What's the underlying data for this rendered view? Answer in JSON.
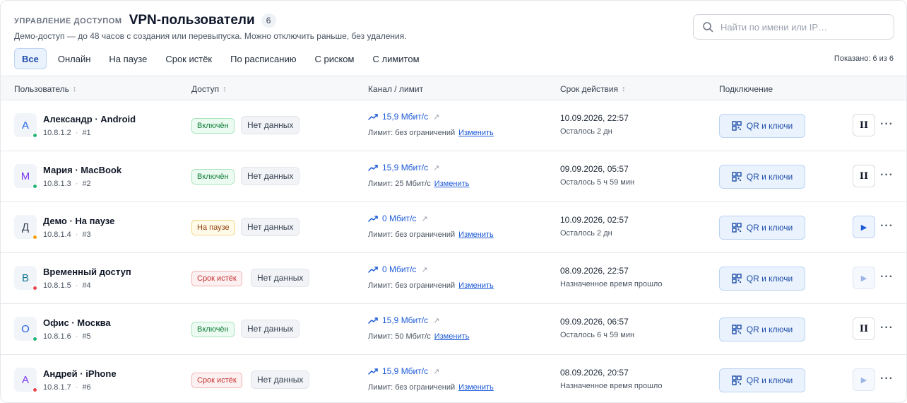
{
  "header": {
    "section_label": "Управление доступом",
    "title": "VPN-пользователи",
    "count": "6",
    "subtitle": "Демо-доступ — до 48 часов с создания или перевыпуска. Можно отключить раньше, без удаления."
  },
  "search": {
    "placeholder": "Найти по имени или IP…",
    "icon": "search-icon"
  },
  "tabs": [
    {
      "label": "Все",
      "active": true
    },
    {
      "label": "Онлайн"
    },
    {
      "label": "На паузе"
    },
    {
      "label": "Срок истёк"
    },
    {
      "label": "По расписанию"
    },
    {
      "label": "С риском"
    },
    {
      "label": "С лимитом"
    }
  ],
  "shown_text": "Показано: 6 из 6",
  "columns": {
    "user": "Пользователь",
    "access": "Доступ",
    "channel": "Канал / лимит",
    "expiry": "Срок действия",
    "connection": "Подключение"
  },
  "colors": {
    "accent": "#1d5bd8",
    "online": "#22b573",
    "paused": "#f59e0b",
    "expired": "#e5484d"
  },
  "rows": [
    {
      "initial": "А",
      "initial_color": "#2563eb",
      "name": "Александр · Android",
      "ip": "10.8.1.2",
      "num": "#1",
      "dot": "#22b573",
      "status": "Включён",
      "status_kind": "on",
      "data": "Нет данных",
      "speed": "15,9 Мбит/с",
      "limit": "Лимит: без ограничений",
      "change": "Изменить",
      "exp_date": "10.09.2026, 22:57",
      "exp_left": "Осталось 2 дн",
      "qr": "QR и ключи",
      "control": "pause"
    },
    {
      "initial": "М",
      "initial_color": "#7c3aed",
      "name": "Мария · MacBook",
      "ip": "10.8.1.3",
      "num": "#2",
      "dot": "#22b573",
      "status": "Включён",
      "status_kind": "on",
      "data": "Нет данных",
      "speed": "15,9 Мбит/с",
      "limit": "Лимит: 25 Мбит/с",
      "change": "Изменить",
      "exp_date": "09.09.2026, 05:57",
      "exp_left": "Осталось 5 ч 59 мин",
      "qr": "QR и ключи",
      "control": "pause"
    },
    {
      "initial": "Д",
      "initial_color": "#374151",
      "name": "Демо · На паузе",
      "ip": "10.8.1.4",
      "num": "#3",
      "dot": "#f59e0b",
      "status": "На паузе",
      "status_kind": "pause",
      "data": "Нет данных",
      "speed": "0 Мбит/с",
      "limit": "Лимит: без ограничений",
      "change": "Изменить",
      "exp_date": "10.09.2026, 02:57",
      "exp_left": "Осталось 2 дн",
      "qr": "QR и ключи",
      "control": "play"
    },
    {
      "initial": "В",
      "initial_color": "#0e7490",
      "name": "Временный доступ",
      "ip": "10.8.1.5",
      "num": "#4",
      "dot": "#e5484d",
      "status": "Срок истёк",
      "status_kind": "exp",
      "data": "Нет данных",
      "speed": "0 Мбит/с",
      "limit": "Лимит: без ограничений",
      "change": "Изменить",
      "exp_date": "08.09.2026, 22:57",
      "exp_left": "Назначенное время прошло",
      "qr": "QR и ключи",
      "control": "play-disabled"
    },
    {
      "initial": "О",
      "initial_color": "#2563eb",
      "name": "Офис · Москва",
      "ip": "10.8.1.6",
      "num": "#5",
      "dot": "#22b573",
      "status": "Включён",
      "status_kind": "on",
      "data": "Нет данных",
      "speed": "15,9 Мбит/с",
      "limit": "Лимит: 50 Мбит/с",
      "change": "Изменить",
      "exp_date": "09.09.2026, 06:57",
      "exp_left": "Осталось 6 ч 59 мин",
      "qr": "QR и ключи",
      "control": "pause"
    },
    {
      "initial": "А",
      "initial_color": "#7c3aed",
      "name": "Андрей · iPhone",
      "ip": "10.8.1.7",
      "num": "#6",
      "dot": "#e5484d",
      "status": "Срок истёк",
      "status_kind": "exp",
      "data": "Нет данных",
      "speed": "15,9 Мбит/с",
      "limit": "Лимит: без ограничений",
      "change": "Изменить",
      "exp_date": "08.09.2026, 20:57",
      "exp_left": "Назначенное время прошло",
      "qr": "QR и ключи",
      "control": "play-disabled"
    }
  ]
}
